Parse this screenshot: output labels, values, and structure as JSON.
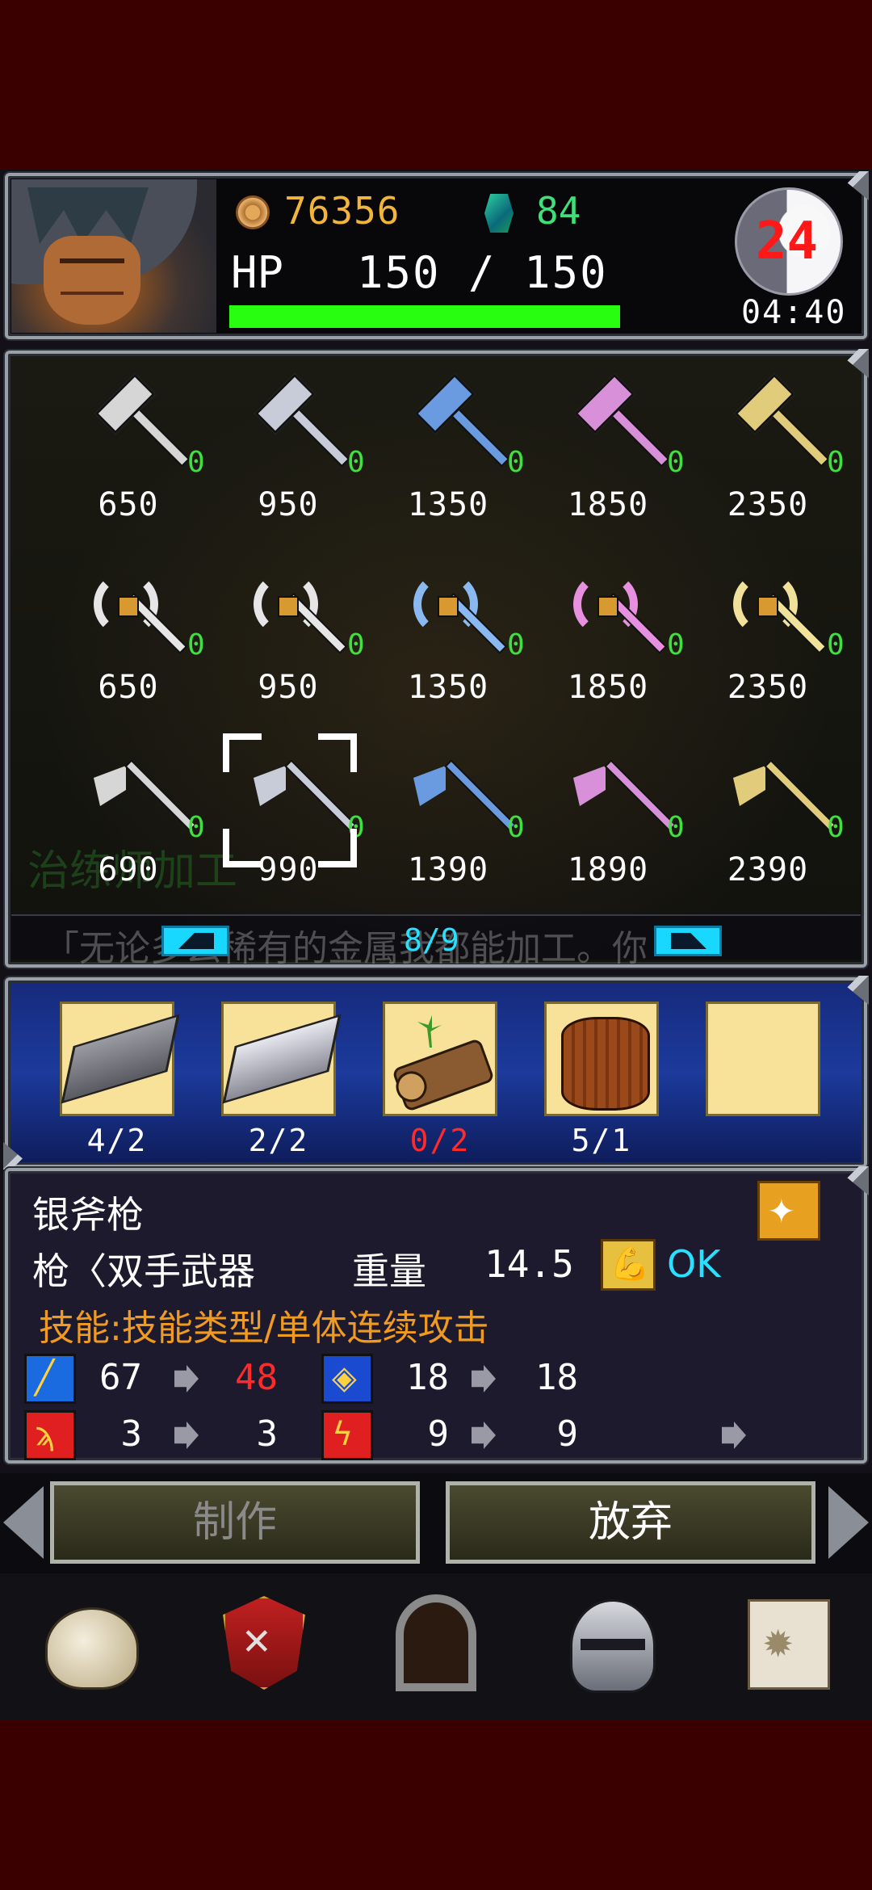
{
  "status": {
    "gold": "76356",
    "gems": "84",
    "hp_label": "HP",
    "hp_value": "150 / 150",
    "hp_fraction": 1.0,
    "level": "24",
    "clock": "04:40"
  },
  "grid": {
    "background_text": "治练师加工",
    "rows": [
      {
        "type": "hammer",
        "items": [
          {
            "color": "#d6d6d6",
            "count": "0",
            "price": "650"
          },
          {
            "color": "#c8ccd8",
            "count": "0",
            "price": "950"
          },
          {
            "color": "#6a9ae0",
            "count": "0",
            "price": "1350"
          },
          {
            "color": "#d890d8",
            "count": "0",
            "price": "1850"
          },
          {
            "color": "#e0cc7a",
            "count": "0",
            "price": "2350"
          }
        ]
      },
      {
        "type": "axe",
        "items": [
          {
            "color": "#e6e6e6",
            "count": "0",
            "price": "650"
          },
          {
            "color": "#e6e6e6",
            "count": "0",
            "price": "950"
          },
          {
            "color": "#8ab8f0",
            "count": "0",
            "price": "1350"
          },
          {
            "color": "#e890e0",
            "count": "0",
            "price": "1850"
          },
          {
            "color": "#f0e29a",
            "count": "0",
            "price": "2350"
          }
        ]
      },
      {
        "type": "halberd",
        "items": [
          {
            "color": "#d6d6d6",
            "count": "0",
            "price": "690"
          },
          {
            "color": "#c8ccd8",
            "count": "0",
            "price": "990"
          },
          {
            "color": "#6a9ae0",
            "count": "0",
            "price": "1390"
          },
          {
            "color": "#d890d8",
            "count": "0",
            "price": "1890"
          },
          {
            "color": "#e0cc7a",
            "count": "0",
            "price": "2390"
          }
        ]
      }
    ],
    "selected": {
      "row": 2,
      "col": 1
    },
    "ticker": "「无论多么稀有的金属我都能加工。你",
    "page": "8/9"
  },
  "materials": [
    {
      "kind": "iron-ingot",
      "count": "4/2",
      "short": false
    },
    {
      "kind": "silver-ingot",
      "count": "2/2",
      "short": false
    },
    {
      "kind": "wood-log",
      "count": "0/2",
      "short": true
    },
    {
      "kind": "wooden-barrel",
      "count": "5/1",
      "short": false
    },
    {
      "kind": "empty",
      "count": "",
      "short": false
    }
  ],
  "item": {
    "name": "银斧枪",
    "category": "枪〈双手武器",
    "weight_label": "重量",
    "weight": "14.5",
    "requirement_status": "OK",
    "skill": "技能:技能类型/单体连续攻击",
    "stats": {
      "attack": {
        "from": "67",
        "to": "48"
      },
      "defense": {
        "from": "18",
        "to": "18"
      },
      "magic": {
        "from": "3",
        "to": "3"
      },
      "resist": {
        "from": "9",
        "to": "9"
      }
    }
  },
  "actions": {
    "craft": "制作",
    "abandon": "放弃"
  },
  "nav": [
    "item-bag",
    "battle-emblem",
    "dungeon-door",
    "equipment-helmet",
    "map-scroll"
  ],
  "colors": {
    "outer_bg": "#3a0000",
    "gold_text": "#f2b53c",
    "gem_text": "#3fe07a",
    "hp_bar": "#28ff10",
    "count_green": "#3fe03f",
    "warn_red": "#ff2a2a",
    "skill_orange": "#f09a20",
    "ok_cyan": "#28e0ff"
  }
}
